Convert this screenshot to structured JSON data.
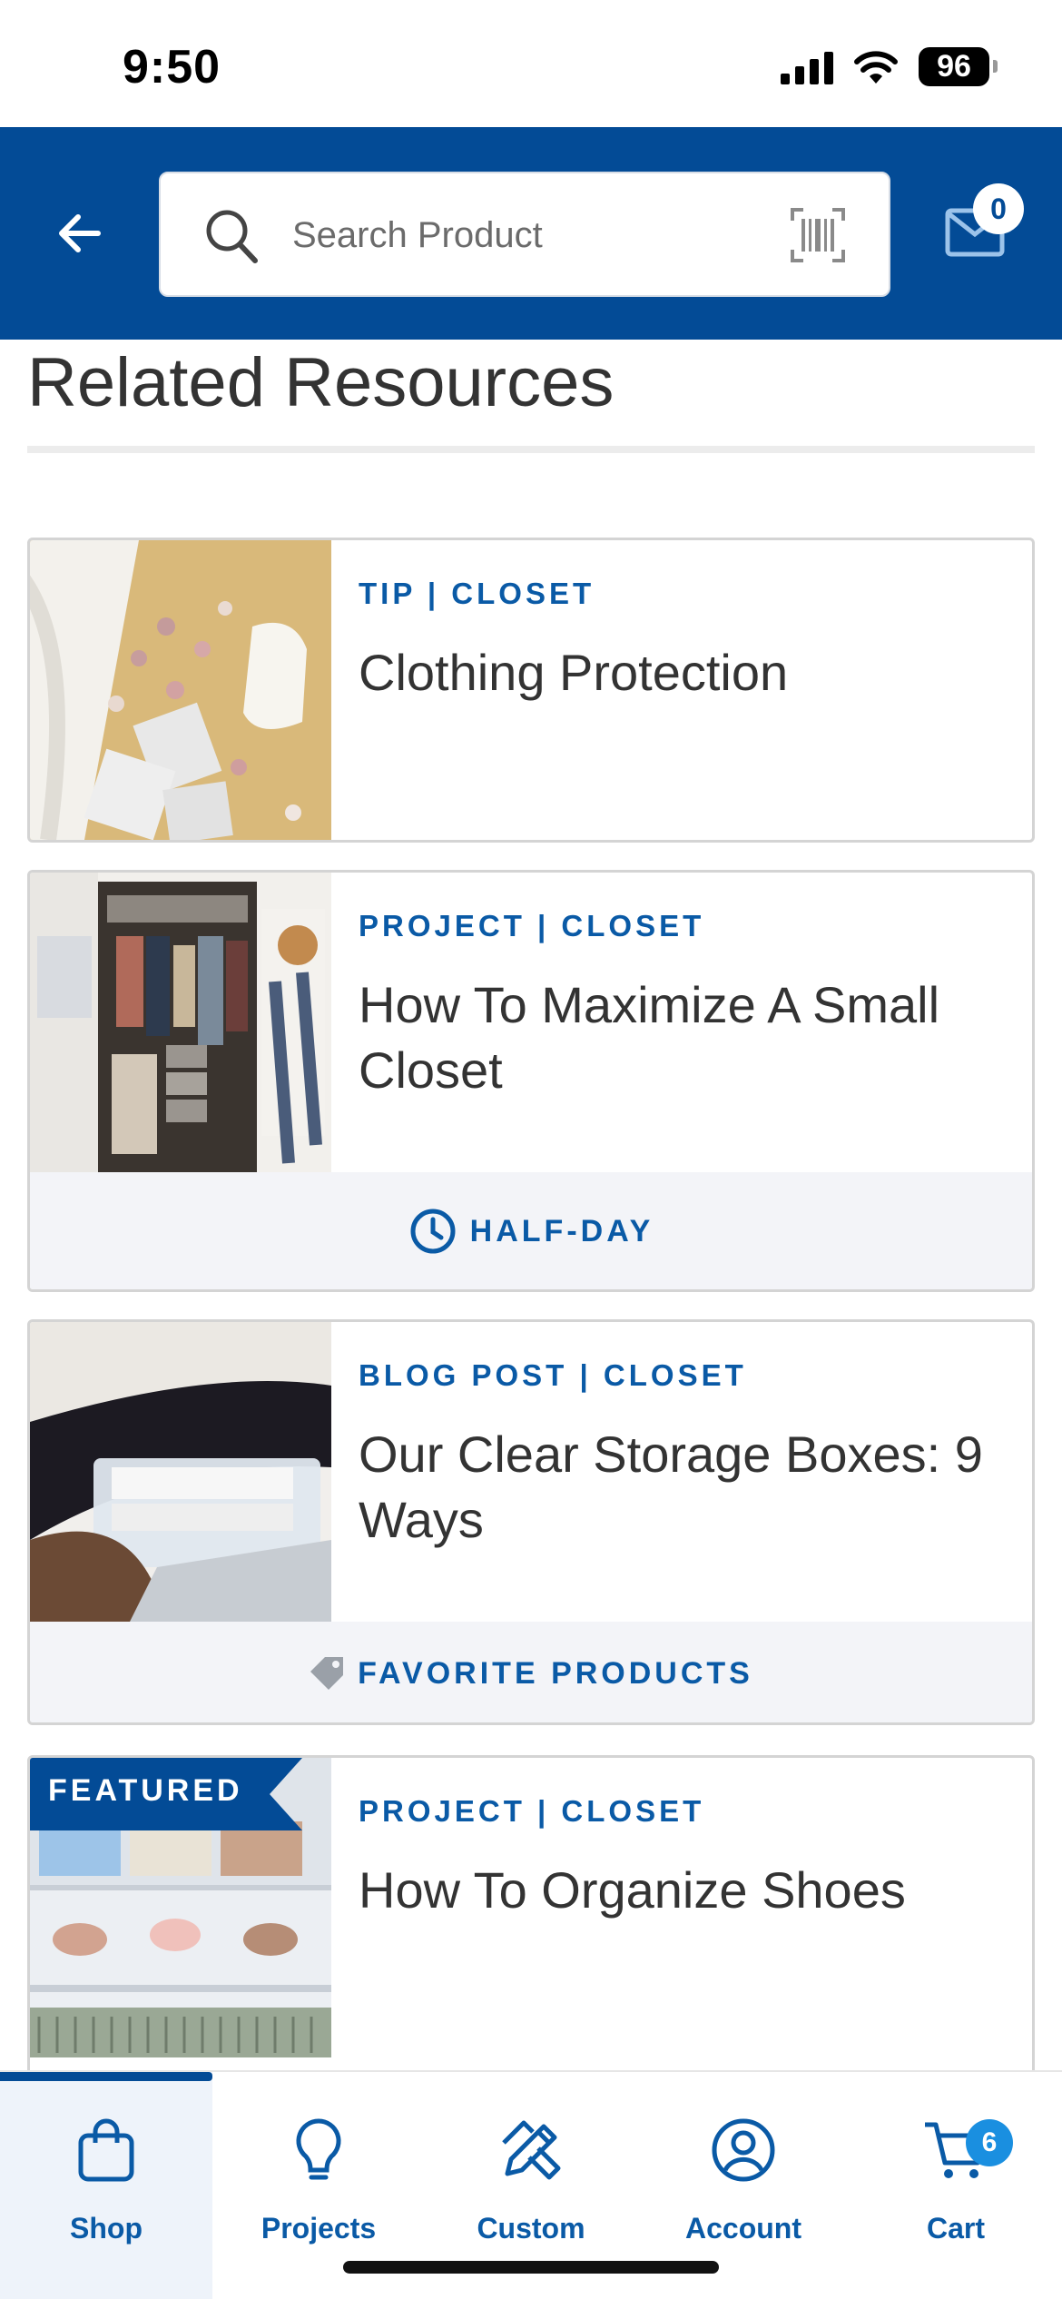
{
  "status_bar": {
    "time": "9:50",
    "battery": "96"
  },
  "header": {
    "search_placeholder": "Search Product",
    "mail_count": "0"
  },
  "section_title": "Related Resources",
  "cards": [
    {
      "category": "TIP | CLOSET",
      "title": "Clothing Protection"
    },
    {
      "category": "PROJECT | CLOSET",
      "title": "How To Maximize A Small Closet",
      "footer": "HALF-DAY",
      "footer_icon": "clock-icon"
    },
    {
      "category": "BLOG POST | CLOSET",
      "title": "Our Clear Storage Boxes: 9 Ways",
      "footer": "FAVORITE PRODUCTS",
      "footer_icon": "tag-icon"
    },
    {
      "badge": "FEATURED",
      "category": "PROJECT | CLOSET",
      "title": "How To Organize Shoes"
    }
  ],
  "bottom_nav": {
    "items": [
      {
        "label": "Shop",
        "icon": "bag-icon",
        "active": true
      },
      {
        "label": "Projects",
        "icon": "lightbulb-icon"
      },
      {
        "label": "Custom",
        "icon": "pencil-ruler-icon"
      },
      {
        "label": "Account",
        "icon": "user-circle-icon"
      },
      {
        "label": "Cart",
        "icon": "cart-icon",
        "badge": "6"
      }
    ]
  },
  "colors": {
    "brand": "#034b96",
    "accent": "#0a5aa6",
    "badge": "#1a8fe0"
  }
}
